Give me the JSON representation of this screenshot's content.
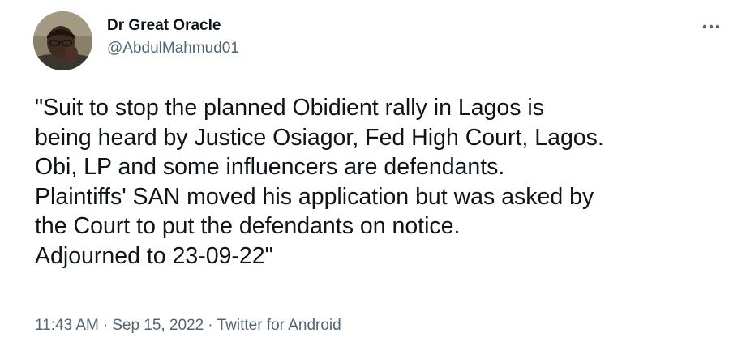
{
  "author": {
    "display_name": "Dr Great Oracle",
    "handle": "@AbdulMahmud01",
    "avatar_icon": "user-photo-avatar"
  },
  "menu": {
    "icon": "more-horizontal-icon",
    "glyph": "•••"
  },
  "tweet": {
    "text": "\"Suit to stop the planned Obidient rally in Lagos is\nbeing heard by Justice Osiagor, Fed High Court, Lagos.\nObi, LP and some influencers are defendants.\nPlaintiffs' SAN moved his application but was asked by\nthe Court to put the defendants on notice.\nAdjourned to 23-09-22\""
  },
  "meta": {
    "time": "11:43 AM",
    "separator": "·",
    "date": "Sep 15, 2022",
    "source": "Twitter for Android"
  },
  "colors": {
    "text_primary": "#0f1419",
    "text_secondary": "#536471",
    "background": "#ffffff"
  }
}
